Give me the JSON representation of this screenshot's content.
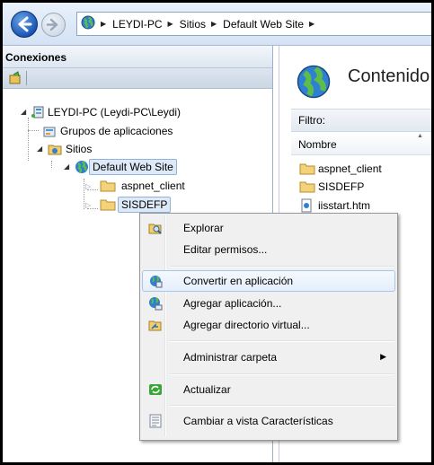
{
  "address_bar": {
    "crumbs": [
      "LEYDI-PC",
      "Sitios",
      "Default Web Site"
    ],
    "icons": {
      "back": "back-arrow-icon",
      "forward": "forward-arrow-icon",
      "globe": "globe-icon"
    }
  },
  "connections": {
    "header": "Conexiones",
    "tree": [
      {
        "label": "LEYDI-PC (Leydi-PC\\Leydi)",
        "icon": "server-icon",
        "expanded": true
      },
      {
        "label": "Grupos de aplicaciones",
        "icon": "app-pools-icon"
      },
      {
        "label": "Sitios",
        "icon": "sites-folder-icon",
        "expanded": true
      },
      {
        "label": "Default Web Site",
        "icon": "globe-icon",
        "expanded": true,
        "selected": true
      },
      {
        "label": "aspnet_client",
        "icon": "folder-icon",
        "expanded": false
      },
      {
        "label": "SISDEFP",
        "icon": "folder-icon",
        "expanded": false,
        "selected": true
      }
    ]
  },
  "content": {
    "title": "Contenido",
    "filter_label": "Filtro:",
    "column_header": "Nombre",
    "items": [
      {
        "label": "aspnet_client",
        "icon": "folder-icon"
      },
      {
        "label": "SISDEFP",
        "icon": "folder-icon"
      },
      {
        "label": "iisstart.htm",
        "icon": "html-file-icon"
      }
    ]
  },
  "context_menu": {
    "items": [
      {
        "label": "Explorar",
        "icon": "explore-icon"
      },
      {
        "label": "Editar permisos...",
        "icon": ""
      },
      {
        "label": "Convertir en aplicación",
        "icon": "convert-app-icon",
        "highlighted": true
      },
      {
        "label": "Agregar aplicación...",
        "icon": "add-app-icon"
      },
      {
        "label": "Agregar directorio virtual...",
        "icon": "add-virtual-dir-icon"
      },
      {
        "label": "Administrar carpeta",
        "icon": "",
        "has_submenu": true
      },
      {
        "label": "Actualizar",
        "icon": "refresh-icon"
      },
      {
        "label": "Cambiar a vista Características",
        "icon": "features-view-icon"
      }
    ]
  },
  "colors": {
    "accent": "#1a56b4",
    "selection": "#dde9f7",
    "menu_bg": "#f0f0f0"
  }
}
